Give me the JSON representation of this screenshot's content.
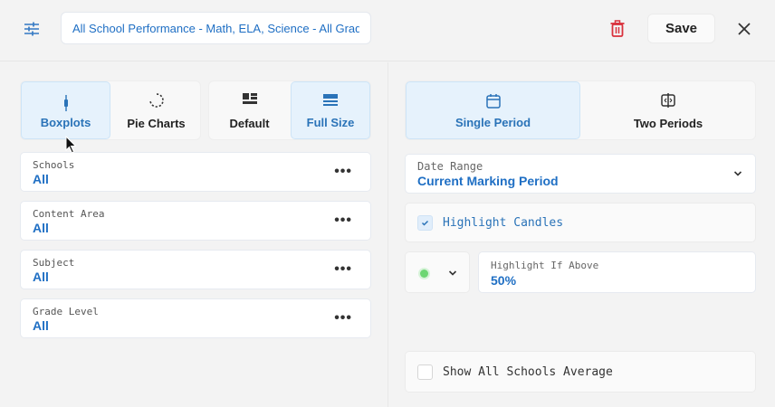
{
  "header": {
    "title_value": "All School Performance - Math, ELA, Science - All Grades",
    "save_label": "Save"
  },
  "chart_types": [
    {
      "label": "Boxplots",
      "active": true
    },
    {
      "label": "Pie Charts",
      "active": false
    }
  ],
  "size_options": [
    {
      "label": "Default",
      "active": false
    },
    {
      "label": "Full Size",
      "active": true
    }
  ],
  "filters": [
    {
      "label": "Schools",
      "value": "All"
    },
    {
      "label": "Content Area",
      "value": "All"
    },
    {
      "label": "Subject",
      "value": "All"
    },
    {
      "label": "Grade Level",
      "value": "All"
    }
  ],
  "period_options": [
    {
      "label": "Single Period",
      "active": true
    },
    {
      "label": "Two Periods",
      "active": false
    }
  ],
  "date_range": {
    "label": "Date Range",
    "value": "Current Marking Period"
  },
  "highlight_candles": {
    "label": "Highlight Candles",
    "checked": true
  },
  "highlight_color": "#6dd673",
  "highlight_if_above": {
    "label": "Highlight If Above",
    "value": "50%"
  },
  "show_average": {
    "label": "Show All Schools Average",
    "checked": false
  },
  "colors": {
    "accent": "#1f6fc4",
    "active_bg": "#e6f2fc",
    "danger": "#d9313c"
  }
}
